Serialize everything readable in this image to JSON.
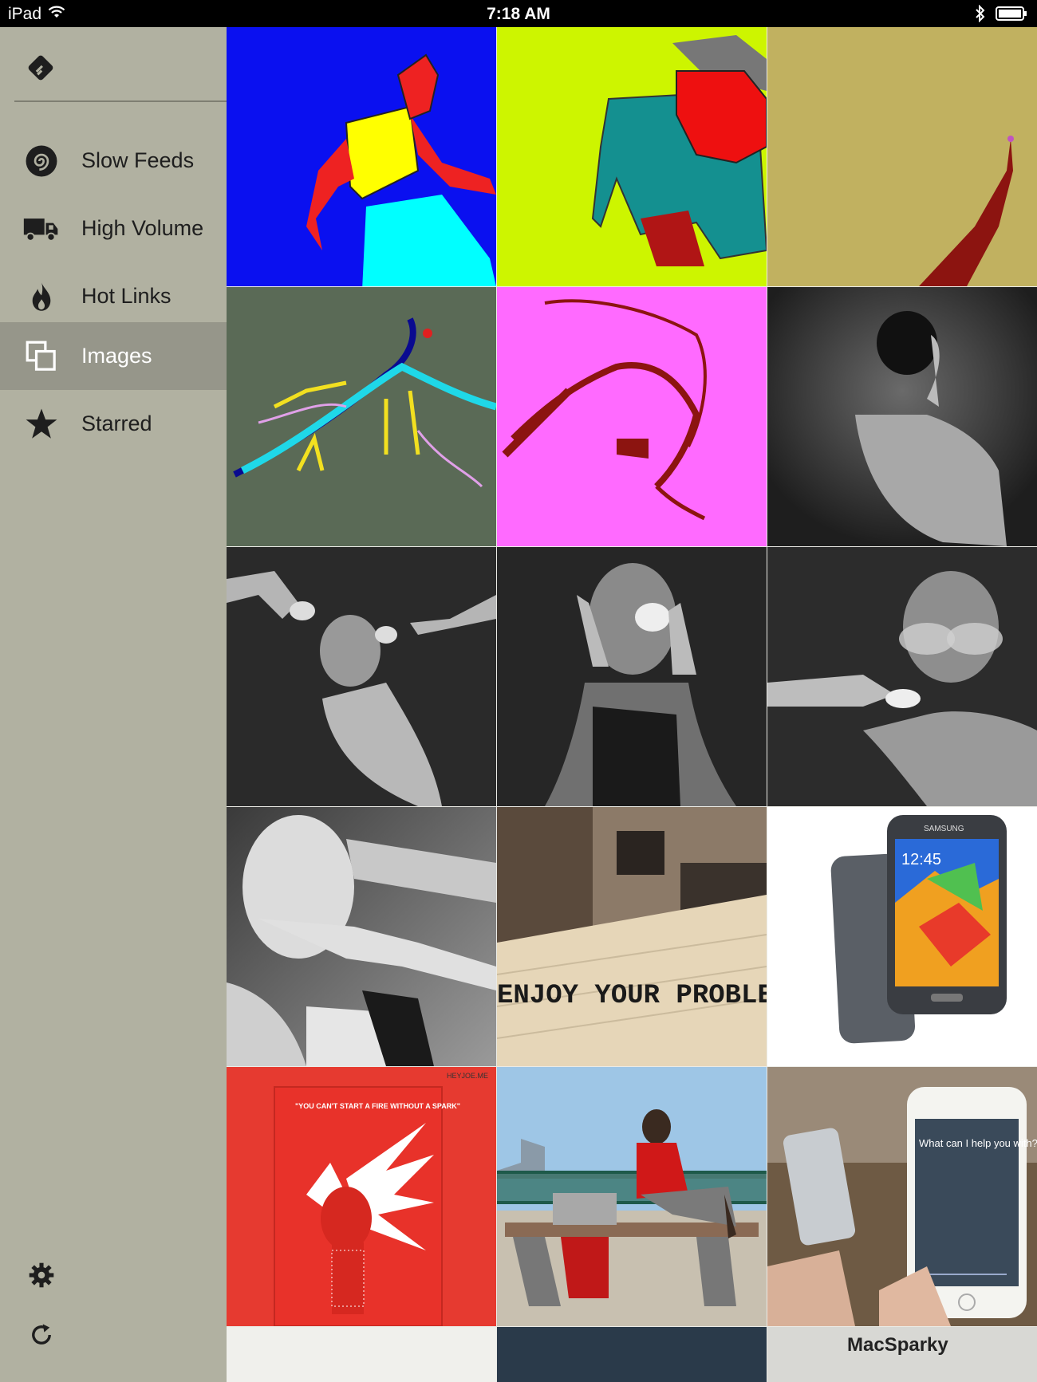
{
  "status_bar": {
    "device": "iPad",
    "time": "7:18 AM"
  },
  "sidebar": {
    "logo_icon": "feedly-logo-icon",
    "items": [
      {
        "label": "Slow Feeds",
        "icon": "spiral-icon",
        "active": false
      },
      {
        "label": "High Volume",
        "icon": "truck-icon",
        "active": false
      },
      {
        "label": "Hot Links",
        "icon": "flame-icon",
        "active": false
      },
      {
        "label": "Images",
        "icon": "images-icon",
        "active": true
      },
      {
        "label": "Starred",
        "icon": "star-icon",
        "active": false
      }
    ],
    "settings_icon": "gear-icon",
    "refresh_icon": "refresh-icon"
  },
  "grid": {
    "tiles": [
      {
        "desc": "blue drawing figure",
        "bg": "#0a10f0"
      },
      {
        "desc": "lime drawing boy",
        "bg": "#cdf500"
      },
      {
        "desc": "tan drawing tower",
        "bg": "#c1b160"
      },
      {
        "desc": "green sketch figure",
        "bg": "#5a6a56"
      },
      {
        "desc": "magenta sketch",
        "bg": "#ff6aff"
      },
      {
        "desc": "bw portrait 1",
        "bg": "#3a3a3a"
      },
      {
        "desc": "bw portrait 2",
        "bg": "#2a2a2a"
      },
      {
        "desc": "bw portrait 3",
        "bg": "#2c2c2c"
      },
      {
        "desc": "bw portrait 4",
        "bg": "#2f2f2f"
      },
      {
        "desc": "bw portrait 5",
        "bg": "#6a6a6a"
      },
      {
        "desc": "wall graffiti",
        "bg": "#d8c6a8"
      },
      {
        "desc": "samsung phone",
        "bg": "#ffffff"
      },
      {
        "desc": "red poster",
        "bg": "#e63a30"
      },
      {
        "desc": "woman on bench",
        "bg": "#9ec6e6"
      },
      {
        "desc": "iphone siri",
        "bg": "#6e5a44"
      }
    ],
    "graffiti_text": "ENJOY YOUR PROBLE",
    "poster_quote": "\"YOU CAN'T START A FIRE WITHOUT A SPARK\"",
    "poster_brand": "HEYJOE.ME",
    "phone_time": "12:45",
    "samsung_brand": "SAMSUNG",
    "siri_prompt": "What can I help you with?",
    "bottom_peek_text": "MacSparky"
  }
}
